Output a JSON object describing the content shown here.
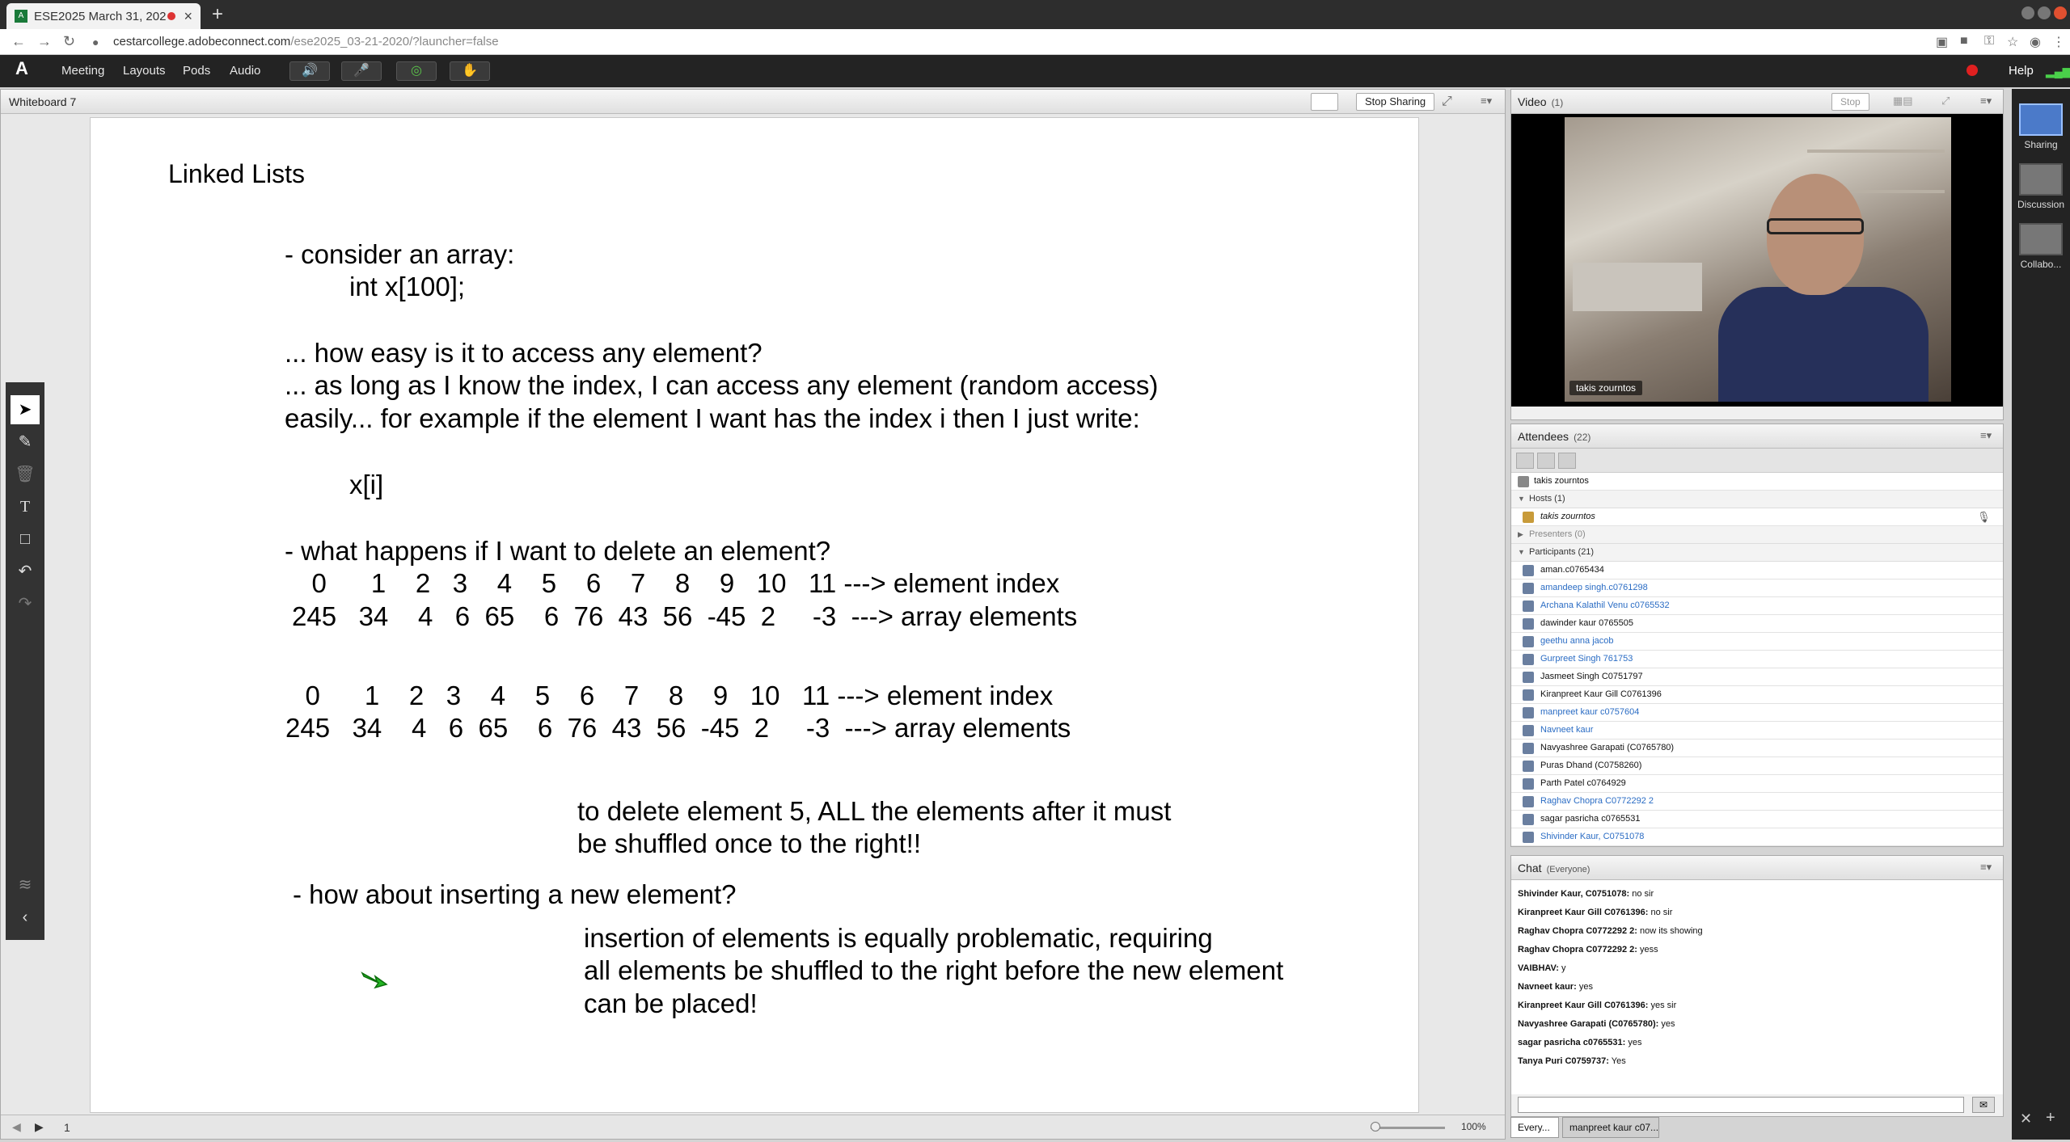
{
  "browser": {
    "tab_title": "ESE2025 March 31, 202",
    "new_tab": "+",
    "url_host": "cestarcollege.adobeconnect.com",
    "url_path": "/ese2025_03-21-2020/?launcher=false"
  },
  "toolbar": {
    "logo": "A",
    "menus": [
      "Meeting",
      "Layouts",
      "Pods",
      "Audio"
    ],
    "help": "Help"
  },
  "whiteboard": {
    "title": "Whiteboard 7",
    "stop_sharing": "Stop Sharing",
    "page_number": "1",
    "zoom": "100%",
    "lines": {
      "title": "Linked Lists",
      "l1": "- consider an array:",
      "l2": "int x[100];",
      "l3": "... how easy is it to access any element?",
      "l4": "... as long as I know the index, I can access any element (random access)",
      "l5": "easily... for example if the element I want has the index i then I just write:",
      "l6": "x[i]",
      "l7": "- what happens if I want to delete an element?",
      "l8": "   0      1    2   3    4    5    6    7    8    9   10   11 ---> element index",
      "l9": "245   34    4   6  65    6  76  43  56  -45  2     -3  ---> array elements",
      "l10": "   0      1    2   3    4    5    6    7    8    9   10   11 ---> element index",
      "l11": "245   34    4   6  65    6  76  43  56  -45  2     -3  ---> array elements",
      "l12": "to delete element 5, ALL the elements after it must",
      "l13": "be shuffled once to the right!!",
      "l14": "- how about inserting a new element?",
      "l15": "insertion of elements is equally problematic, requiring",
      "l16": "all elements be shuffled to the right before the new element",
      "l17": "can be placed!"
    }
  },
  "video": {
    "title": "Video",
    "count": "(1)",
    "stop": "Stop",
    "label": "takis zourntos"
  },
  "attendees": {
    "title": "Attendees",
    "count": "(22)",
    "speaker": "takis zourntos",
    "hosts_label": "Hosts (1)",
    "host": "takis zourntos",
    "presenters_label": "Presenters (0)",
    "participants_label": "Participants (21)",
    "participants": [
      {
        "name": "aman.c0765434",
        "blue": false
      },
      {
        "name": "amandeep singh.c0761298",
        "blue": true
      },
      {
        "name": "Archana Kalathil Venu c0765532",
        "blue": true
      },
      {
        "name": "dawinder kaur 0765505",
        "blue": false
      },
      {
        "name": "geethu anna jacob",
        "blue": true
      },
      {
        "name": "Gurpreet Singh 761753",
        "blue": true
      },
      {
        "name": "Jasmeet Singh C0751797",
        "blue": false
      },
      {
        "name": "Kiranpreet Kaur Gill C0761396",
        "blue": false
      },
      {
        "name": "manpreet kaur c0757604",
        "blue": true
      },
      {
        "name": "Navneet kaur",
        "blue": true
      },
      {
        "name": "Navyashree Garapati (C0765780)",
        "blue": false
      },
      {
        "name": "Puras Dhand (C0758260)",
        "blue": false
      },
      {
        "name": "Parth Patel c0764929",
        "blue": false
      },
      {
        "name": "Raghav Chopra C0772292 2",
        "blue": true
      },
      {
        "name": "sagar pasricha c0765531",
        "blue": false
      },
      {
        "name": "Shivinder Kaur, C0751078",
        "blue": true
      }
    ]
  },
  "chat": {
    "title": "Chat",
    "scope": "(Everyone)",
    "messages": [
      {
        "from": "Shivinder Kaur, C0751078:",
        "text": "no sir"
      },
      {
        "from": "Kiranpreet Kaur Gill C0761396:",
        "text": "no sir"
      },
      {
        "from": "Raghav Chopra C0772292 2:",
        "text": "now its showing"
      },
      {
        "from": "Raghav Chopra C0772292 2:",
        "text": "yess"
      },
      {
        "from": "VAIBHAV:",
        "text": "y"
      },
      {
        "from": "Navneet kaur:",
        "text": "yes"
      },
      {
        "from": "Kiranpreet Kaur Gill C0761396:",
        "text": "yes sir"
      },
      {
        "from": "Navyashree Garapati (C0765780):",
        "text": "yes"
      },
      {
        "from": "sagar pasricha c0765531:",
        "text": "yes"
      },
      {
        "from": "Tanya Puri C0759737:",
        "text": "Yes"
      }
    ],
    "tabs": [
      "Every...",
      "manpreet kaur c07..."
    ]
  },
  "layouts": [
    "Sharing",
    "Discussion",
    "Collabo..."
  ]
}
